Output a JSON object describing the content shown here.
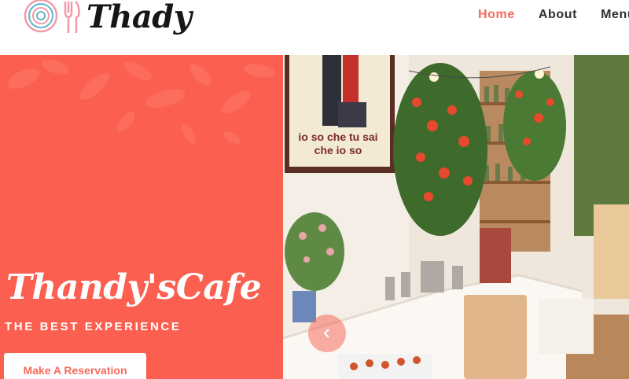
{
  "brand": {
    "name": "Thady"
  },
  "nav": {
    "items": [
      {
        "label": "Home",
        "active": true
      },
      {
        "label": "About",
        "active": false
      },
      {
        "label": "Menu",
        "active": false
      }
    ]
  },
  "hero": {
    "title": "Thandy'sCafe",
    "subtitle": "THE BEST EXPERIENCE",
    "cta_label": "Make A Reservation",
    "poster_text_line1": "io so che tu sai",
    "poster_text_line2": "che io so"
  },
  "colors": {
    "accent": "#f56b5c",
    "hero_panel": "#fa5f50",
    "text_dark": "#2f2f2f"
  },
  "icons": {
    "logo": "plate-and-cutlery-icon",
    "slider_prev": "chevron-left-icon"
  }
}
